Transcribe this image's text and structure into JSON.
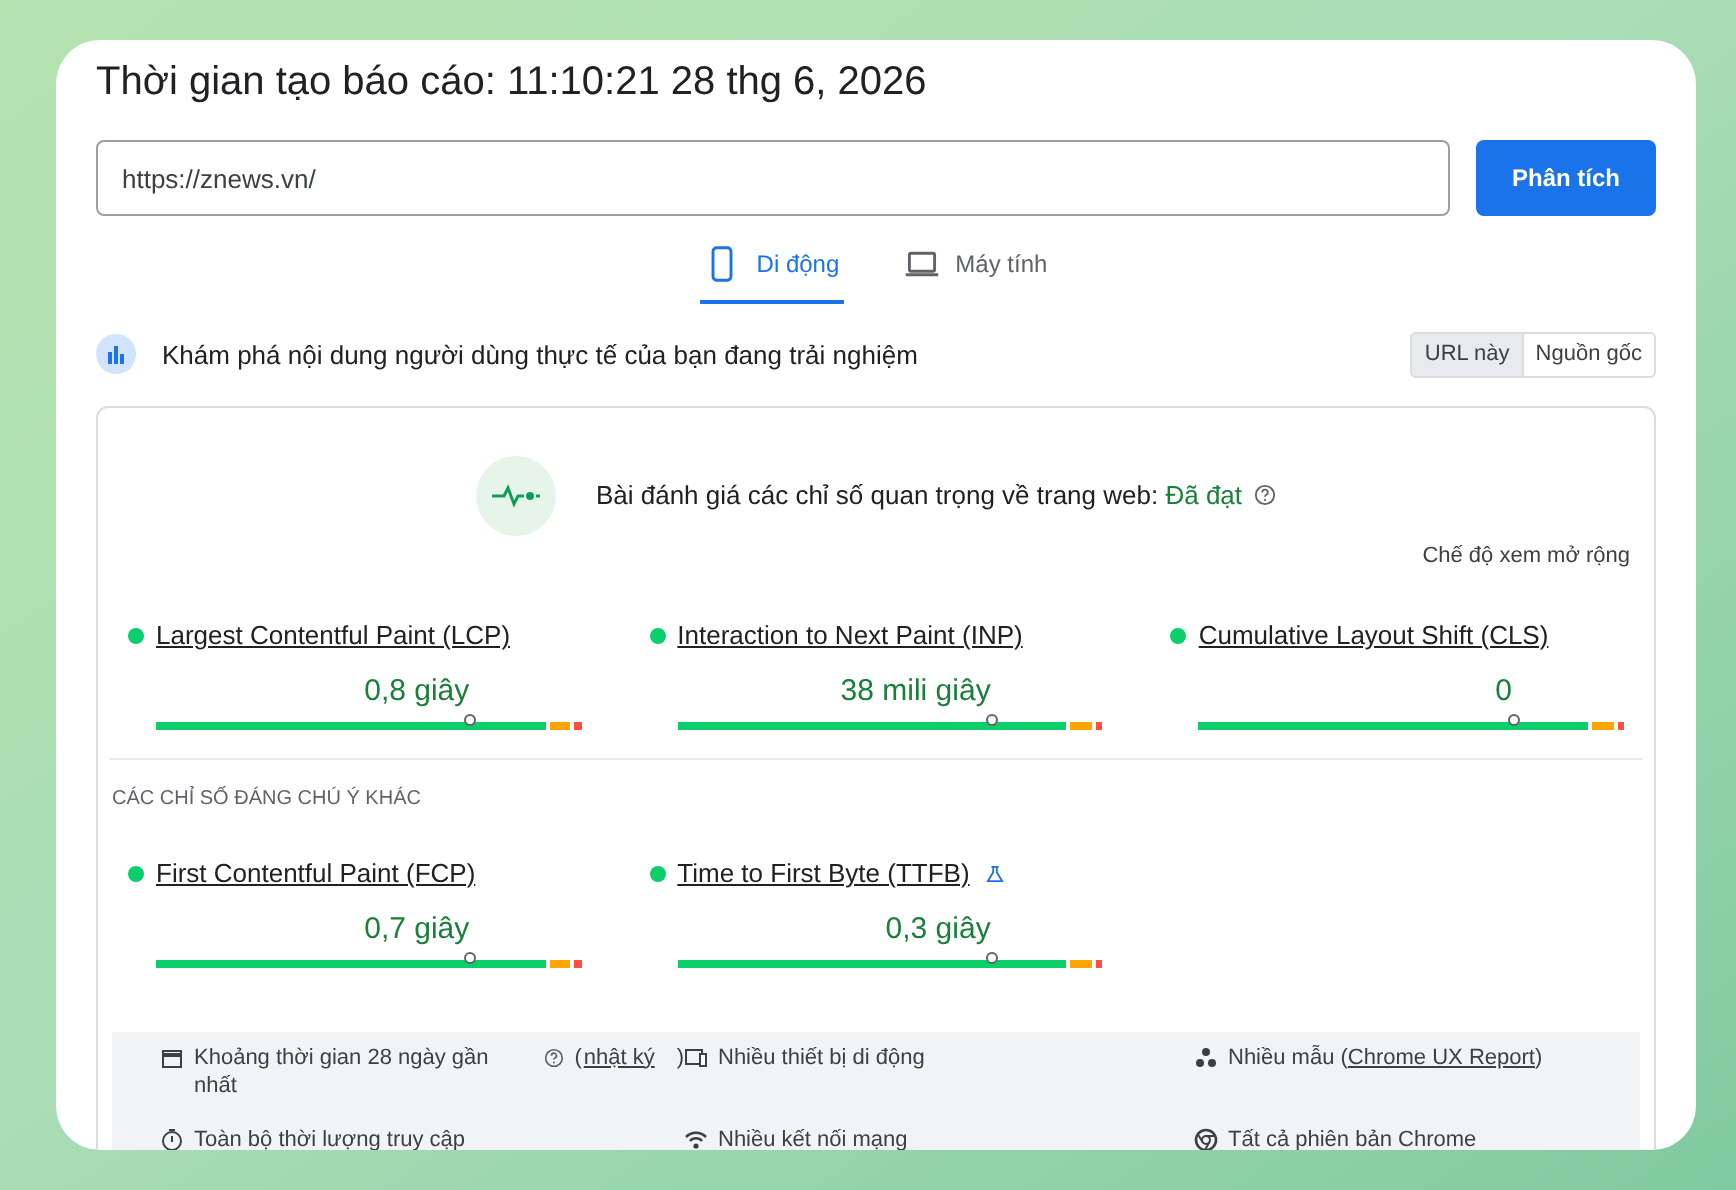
{
  "report_time": "Thời gian tạo báo cáo: 11:10:21 28 thg 6, 2026",
  "url_field": {
    "value": "https://znews.vn/"
  },
  "analyze_button": "Phân tích",
  "tabs": [
    {
      "label": "Di động",
      "kind": "phone",
      "selected": true
    },
    {
      "label": "Máy tính",
      "kind": "laptop",
      "selected": false
    }
  ],
  "section_title": "Khám phá nội dung người dùng thực tế của bạn đang trải nghiệm",
  "source_toggle": [
    {
      "label": "URL này",
      "selected": true
    },
    {
      "label": "Nguồn gốc",
      "selected": false
    }
  ],
  "assessment": {
    "text": "Bài đánh giá các chỉ số quan trọng về trang web:",
    "result": "Đã đạt",
    "passed": true
  },
  "expanded_view": "Chế độ xem mở rộng",
  "core_metrics": [
    {
      "name": "Largest Contentful Paint (LCP)",
      "value": "0,8 giây",
      "level": 0.74,
      "color": "#0cce6b"
    },
    {
      "name": "Interaction to Next Paint (INP)",
      "value": "38 mili giây",
      "level": 0.74,
      "color": "#0cce6b"
    },
    {
      "name": "Cumulative Layout Shift (CLS)",
      "value": "0",
      "level": 0.74,
      "color": "#0cce6b"
    }
  ],
  "other_heading": "CÁC CHỈ SỐ ĐÁNG CHÚ Ý KHÁC",
  "other_metrics": [
    {
      "name": "First Contentful Paint (FCP)",
      "value": "0,7 giây",
      "level": 0.74,
      "color": "#0cce6b",
      "experimental": false
    },
    {
      "name": "Time to First Byte (TTFB)",
      "value": "0,3 giây",
      "level": 0.74,
      "color": "#0cce6b",
      "experimental": true
    }
  ],
  "info": [
    {
      "kind": "calendar",
      "text": "Khoảng thời gian 28 ngày gần nhất",
      "help": true,
      "prefix": "(",
      "link": "nhật ký",
      "suffix": ")"
    },
    {
      "kind": "devices",
      "text": "Nhiều thiết bị di động"
    },
    {
      "kind": "samples",
      "text": "Nhiều mẫu (",
      "link": "Chrome UX Report",
      "suffix": ")"
    },
    {
      "kind": "timer",
      "text": "Toàn bộ thời lượng truy cập"
    },
    {
      "kind": "wifi",
      "text": "Nhiều kết nối mạng"
    },
    {
      "kind": "chrome",
      "text": "Tất cả phiên bản Chrome"
    }
  ]
}
